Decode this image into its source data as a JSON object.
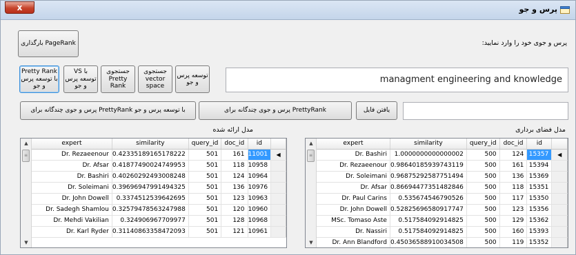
{
  "window": {
    "title": "پرس و جو",
    "close_label": "x"
  },
  "buttons": {
    "pagerank_load": "بارگذاری PageRank",
    "expand_query": "توسعه پرس و جو",
    "search_vector_space": "جستجوی vector space",
    "search_pretty_rank": "جستجوی Pretty Rank",
    "vs_with_expansion": "VS با توسعه پرس و جو",
    "pretty_rank_with_expansion": "Pretty Rank با توسعه پرس و جو",
    "find_file": "یافتن فایل",
    "multi_query_prettyrank": "پرس و جوی چندگانه برای PrettyRank",
    "multi_query_prettyrank_expansion": "پرس و جوی چندگانه برای PrettyRank با توسعه پرس و جو"
  },
  "prompt_label": "پرس و جوی خود را وارد نمایید:",
  "query_value": "managment engineering and knowledge",
  "file_path_value": "",
  "left_grid": {
    "caption": "مدل ارائه شده",
    "columns": [
      "expert",
      "similarity",
      "query_id",
      "doc_id",
      "id"
    ],
    "rows": [
      [
        "Dr. Rezaeenour",
        "0.42335189165178222",
        "501",
        "161",
        "11001"
      ],
      [
        "Dr. Afsar",
        "0.41877490024749953",
        "501",
        "118",
        "10958"
      ],
      [
        "Dr. Bashiri",
        "0.40260292493008248",
        "501",
        "124",
        "10964"
      ],
      [
        "Dr. Soleimani",
        "0.39696947991494325",
        "501",
        "136",
        "10976"
      ],
      [
        "Dr. John Dowell",
        "0.3374512539642695",
        "501",
        "123",
        "10963"
      ],
      [
        "Dr. Sadegh Shamlou",
        "0.32579478563247988",
        "501",
        "120",
        "10960"
      ],
      [
        "Dr. Mehdi Vakilian",
        "0.324906967709977",
        "501",
        "128",
        "10968"
      ],
      [
        "Dr. Karl Ryder",
        "0.31140863358472093",
        "501",
        "121",
        "10961"
      ]
    ]
  },
  "right_grid": {
    "caption": "مدل فضای برداری",
    "columns": [
      "expert",
      "similarity",
      "query_id",
      "doc_id",
      "id"
    ],
    "rows": [
      [
        "Dr. Bashiri",
        "1.0000000000000002",
        "500",
        "124",
        "15357"
      ],
      [
        "Dr. Rezaeenour",
        "0.98640185939743119",
        "500",
        "161",
        "15394"
      ],
      [
        "Dr. Soleimani",
        "0.96875292587751494",
        "500",
        "136",
        "15369"
      ],
      [
        "Dr. Afsar",
        "0.86694477351482846",
        "500",
        "118",
        "15351"
      ],
      [
        "Dr. Paul Carins",
        "0.535674546790526",
        "500",
        "117",
        "15350"
      ],
      [
        "Dr. John Dowell",
        "0.52825696580917747",
        "500",
        "123",
        "15356"
      ],
      [
        "MSc. Tomaso Aste",
        "0.517584092914825",
        "500",
        "129",
        "15362"
      ],
      [
        "Dr. Nassiri",
        "0.517584092914825",
        "500",
        "160",
        "15393"
      ],
      [
        "Dr. Ann Blandford",
        "0.45036588910034508",
        "500",
        "119",
        "15352"
      ]
    ]
  },
  "colors": {
    "selection": "#3399ff",
    "titlebar": "#c4d5ea",
    "close": "#c7442b"
  },
  "icons": {
    "app": "search-window-icon",
    "row_indicator": "triangle-left-icon"
  }
}
